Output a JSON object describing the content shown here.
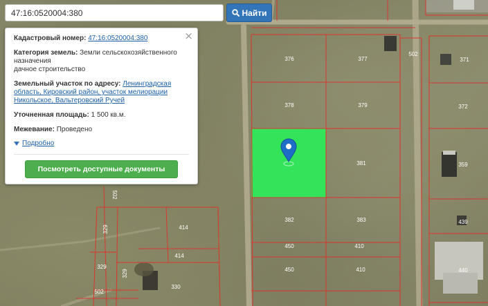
{
  "search": {
    "value": "47:16:0520004:380",
    "button_label": "Найти",
    "icon": "search-icon"
  },
  "info": {
    "cadastral_label": "Кадастровый номер:",
    "cadastral_value": "47:16:0520004:380",
    "category_label": "Категория земель:",
    "category_value": "Земли сельскохозяйственного назначения",
    "usage_value": "дачное строительство",
    "address_label": "Земельный участок по адресу:",
    "address_value": "Ленинградская область, Кировский район, участок мелиорации Никольское, Вальтеровский Ручей",
    "area_label": "Уточненная площадь:",
    "area_value": "1 500 кв.м.",
    "survey_label": "Межевание:",
    "survey_value": "Проведено",
    "details_link": "Подробно",
    "docs_button": "Посмотреть доступные документы"
  },
  "map": {
    "highlight_color": "#2ee85a",
    "boundary_color": "#d9362b",
    "marker_color": "#1e6ec8",
    "plot_labels": [
      "376",
      "377",
      "502",
      "371",
      "378",
      "379",
      "372",
      "381",
      "359",
      "382",
      "383",
      "439",
      "450",
      "410",
      "440",
      "450",
      "410",
      "502",
      "329",
      "414",
      "414",
      "329",
      "329",
      "330",
      "502"
    ]
  }
}
